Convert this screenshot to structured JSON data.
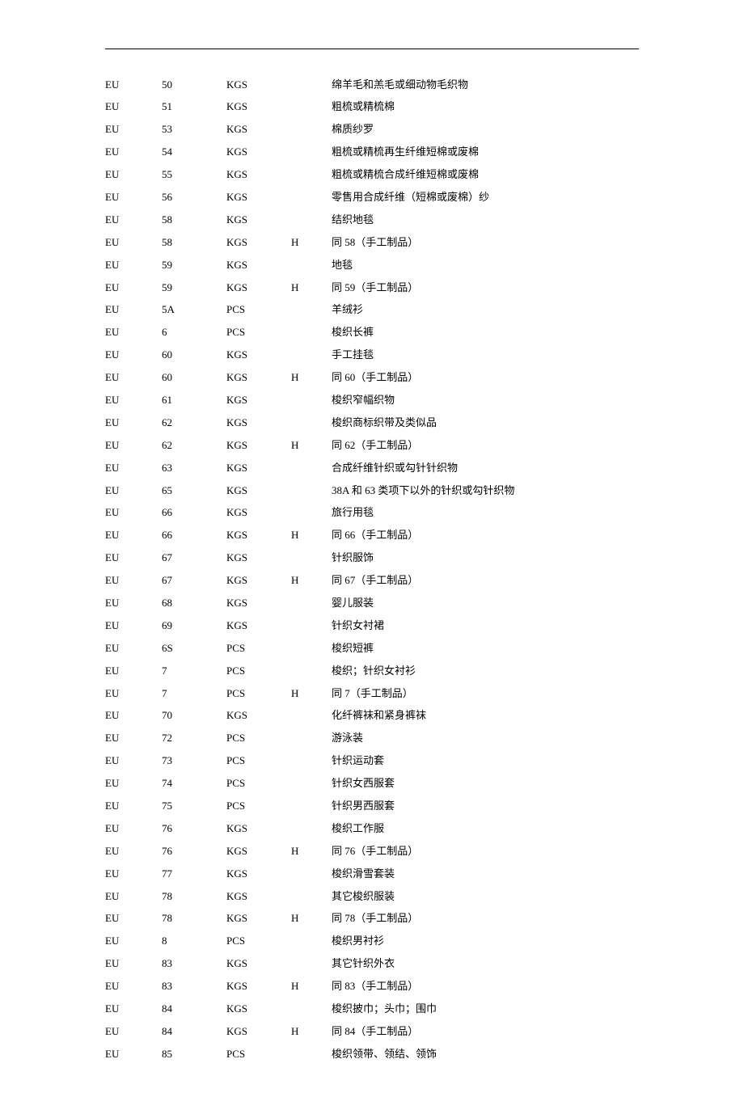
{
  "rows": [
    {
      "region": "EU",
      "code": "50",
      "unit": "KGS",
      "flag": "",
      "desc": "绵羊毛和羔毛或细动物毛织物"
    },
    {
      "region": "EU",
      "code": "51",
      "unit": "KGS",
      "flag": "",
      "desc": "粗梳或精梳棉"
    },
    {
      "region": "EU",
      "code": "53",
      "unit": "KGS",
      "flag": "",
      "desc": "棉质纱罗"
    },
    {
      "region": "EU",
      "code": "54",
      "unit": "KGS",
      "flag": "",
      "desc": "粗梳或精梳再生纤维短棉或废棉"
    },
    {
      "region": "EU",
      "code": "55",
      "unit": "KGS",
      "flag": "",
      "desc": "粗梳或精梳合成纤维短棉或废棉"
    },
    {
      "region": "EU",
      "code": "56",
      "unit": "KGS",
      "flag": "",
      "desc": "零售用合成纤维（短棉或废棉）纱"
    },
    {
      "region": "EU",
      "code": "58",
      "unit": "KGS",
      "flag": "",
      "desc": "结织地毯"
    },
    {
      "region": "EU",
      "code": "58",
      "unit": "KGS",
      "flag": "H",
      "desc": "同 58（手工制品）"
    },
    {
      "region": "EU",
      "code": "59",
      "unit": "KGS",
      "flag": "",
      "desc": "地毯"
    },
    {
      "region": "EU",
      "code": "59",
      "unit": "KGS",
      "flag": "H",
      "desc": "同 59（手工制品）"
    },
    {
      "region": "EU",
      "code": "5A",
      "unit": "PCS",
      "flag": "",
      "desc": "羊绒衫"
    },
    {
      "region": "EU",
      "code": "6",
      "unit": "PCS",
      "flag": "",
      "desc": "梭织长裤"
    },
    {
      "region": "EU",
      "code": "60",
      "unit": "KGS",
      "flag": "",
      "desc": "手工挂毯"
    },
    {
      "region": "EU",
      "code": "60",
      "unit": "KGS",
      "flag": "H",
      "desc": "同 60（手工制品）"
    },
    {
      "region": "EU",
      "code": "61",
      "unit": "KGS",
      "flag": "",
      "desc": "梭织窄幅织物"
    },
    {
      "region": "EU",
      "code": "62",
      "unit": "KGS",
      "flag": "",
      "desc": "梭织商标织带及类似品"
    },
    {
      "region": "EU",
      "code": "62",
      "unit": "KGS",
      "flag": "H",
      "desc": "同 62（手工制品）"
    },
    {
      "region": "EU",
      "code": "63",
      "unit": "KGS",
      "flag": "",
      "desc": "合成纤维针织或勾针针织物"
    },
    {
      "region": "EU",
      "code": "65",
      "unit": "KGS",
      "flag": "",
      "desc": "38A 和 63 类项下以外的针织或勾针织物"
    },
    {
      "region": "EU",
      "code": "66",
      "unit": "KGS",
      "flag": "",
      "desc": "旅行用毯"
    },
    {
      "region": "EU",
      "code": "66",
      "unit": "KGS",
      "flag": "H",
      "desc": "同 66（手工制品）"
    },
    {
      "region": "EU",
      "code": "67",
      "unit": "KGS",
      "flag": "",
      "desc": "针织服饰"
    },
    {
      "region": "EU",
      "code": "67",
      "unit": "KGS",
      "flag": "H",
      "desc": "同 67（手工制品）"
    },
    {
      "region": "EU",
      "code": "68",
      "unit": "KGS",
      "flag": "",
      "desc": "婴儿服装"
    },
    {
      "region": "EU",
      "code": "69",
      "unit": "KGS",
      "flag": "",
      "desc": "针织女衬裙"
    },
    {
      "region": "EU",
      "code": "6S",
      "unit": "PCS",
      "flag": "",
      "desc": "梭织短裤"
    },
    {
      "region": "EU",
      "code": "7",
      "unit": "PCS",
      "flag": "",
      "desc": "梭织；针织女衬衫"
    },
    {
      "region": "EU",
      "code": "7",
      "unit": "PCS",
      "flag": "H",
      "desc": "同 7（手工制品）"
    },
    {
      "region": "EU",
      "code": "70",
      "unit": "KGS",
      "flag": "",
      "desc": "化纤裤袜和紧身裤袜"
    },
    {
      "region": "EU",
      "code": "72",
      "unit": "PCS",
      "flag": "",
      "desc": "游泳装"
    },
    {
      "region": "EU",
      "code": "73",
      "unit": "PCS",
      "flag": "",
      "desc": "针织运动套"
    },
    {
      "region": "EU",
      "code": "74",
      "unit": "PCS",
      "flag": "",
      "desc": "针织女西服套"
    },
    {
      "region": "EU",
      "code": "75",
      "unit": "PCS",
      "flag": "",
      "desc": "针织男西服套"
    },
    {
      "region": "EU",
      "code": "76",
      "unit": "KGS",
      "flag": "",
      "desc": "梭织工作服"
    },
    {
      "region": "EU",
      "code": "76",
      "unit": "KGS",
      "flag": "H",
      "desc": "同 76（手工制品）"
    },
    {
      "region": "EU",
      "code": "77",
      "unit": "KGS",
      "flag": "",
      "desc": "梭织滑雪套装"
    },
    {
      "region": "EU",
      "code": "78",
      "unit": "KGS",
      "flag": "",
      "desc": "其它梭织服装"
    },
    {
      "region": "EU",
      "code": "78",
      "unit": "KGS",
      "flag": "H",
      "desc": "同 78（手工制品）"
    },
    {
      "region": "EU",
      "code": "8",
      "unit": "PCS",
      "flag": "",
      "desc": "梭织男衬衫"
    },
    {
      "region": "EU",
      "code": "83",
      "unit": "KGS",
      "flag": "",
      "desc": "其它针织外衣"
    },
    {
      "region": "EU",
      "code": "83",
      "unit": "KGS",
      "flag": "H",
      "desc": "同 83（手工制品）"
    },
    {
      "region": "EU",
      "code": "84",
      "unit": "KGS",
      "flag": "",
      "desc": "梭织披巾；头巾；围巾"
    },
    {
      "region": "EU",
      "code": "84",
      "unit": "KGS",
      "flag": "H",
      "desc": "同 84（手工制品）"
    },
    {
      "region": "EU",
      "code": "85",
      "unit": "PCS",
      "flag": "",
      "desc": "梭织领带、领结、领饰"
    }
  ]
}
